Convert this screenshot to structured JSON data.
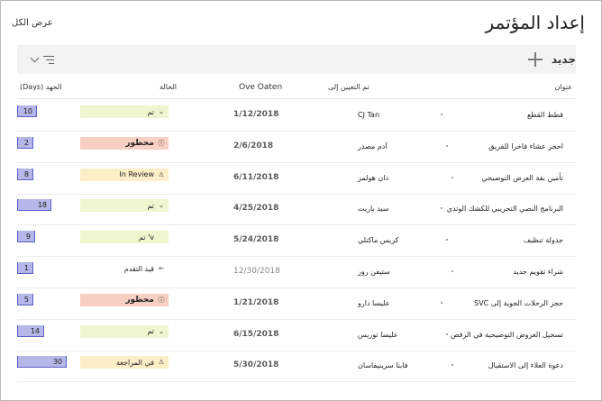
{
  "header": {
    "title": "إعداد المؤتمر",
    "see_all": "عرض الكل"
  },
  "toolbar": {
    "add_label": "جديد"
  },
  "columns": {
    "title": "عنوان",
    "assigned": "تم التعيين إلى",
    "due": "Ove Oaten",
    "status": "الحالة",
    "effort": "الجهد (Days)"
  },
  "colors": {
    "done": "#eef6cf",
    "blocked": "#f7cfc3",
    "review": "#fcefc7",
    "effort": "#b4b7e8",
    "effort_border": "#5b5fc7"
  },
  "rows": [
    {
      "title": "قطط القطع",
      "assigned": "CJ Tan",
      "due": "1/12/2018",
      "status": "تم",
      "status_kind": "done",
      "status_icon": "chevron-down-icon",
      "effort": "10",
      "effort_fraction": 0.22
    },
    {
      "title": "احجز عشاء فاخرا للفريق",
      "assigned": "آدم مصدر",
      "due": "2/6/2018",
      "status": "محظور",
      "status_kind": "blocked",
      "status_icon": "info-icon",
      "effort": "2",
      "effort_fraction": 0.06
    },
    {
      "title": "تأمين بقة العرض التوضيحي",
      "assigned": "دان هولمز",
      "due": "6/11/2018",
      "status": "In Review",
      "status_kind": "review",
      "status_icon": "warning-icon",
      "effort": "8",
      "effort_fraction": 0.18
    },
    {
      "title": "البرنامج النصي التجريبي للكشك الوتدي",
      "assigned": "سيد باريت",
      "due": "4/25/2018",
      "status": "تم",
      "status_kind": "done",
      "status_icon": "chevron-down-icon",
      "effort": "18",
      "effort_fraction": 0.38
    },
    {
      "title": "جدولة تنظيف",
      "assigned": "كريس ماكتلي",
      "due": "5/24/2018",
      "status": "v' تم",
      "status_kind": "done",
      "status_icon": "none",
      "effort": "9",
      "effort_fraction": 0.2
    },
    {
      "title": "شراء تقويم جديد",
      "assigned": "ستيفن روز",
      "due": "12/30/2018",
      "status": "قيد التقدم",
      "status_kind": "progress",
      "status_icon": "arrow-left-icon",
      "effort": "1",
      "effort_fraction": 0.03
    },
    {
      "title": "حجز الرحلات الجوية إلى SVC",
      "assigned": "عليسا دارو",
      "due": "1/21/2018",
      "status": "محظور",
      "status_kind": "blocked",
      "status_icon": "info-icon",
      "effort": "5",
      "effort_fraction": 0.13
    },
    {
      "title": "تسجيل العروض التوضيحية في الرقص",
      "assigned": "عليسا توريس",
      "due": "6/15/2018",
      "status": "تم",
      "status_kind": "done",
      "status_icon": "chevron-down-icon",
      "effort": "14",
      "effort_fraction": 0.3
    },
    {
      "title": "دعوة العلاء إلى الاستقبال",
      "assigned": "فابنا سرينيفاسان",
      "due": "5/30/2018",
      "status": "في المراجعة",
      "status_kind": "review",
      "status_icon": "warning-icon",
      "effort": "30",
      "effort_fraction": 0.55
    }
  ]
}
